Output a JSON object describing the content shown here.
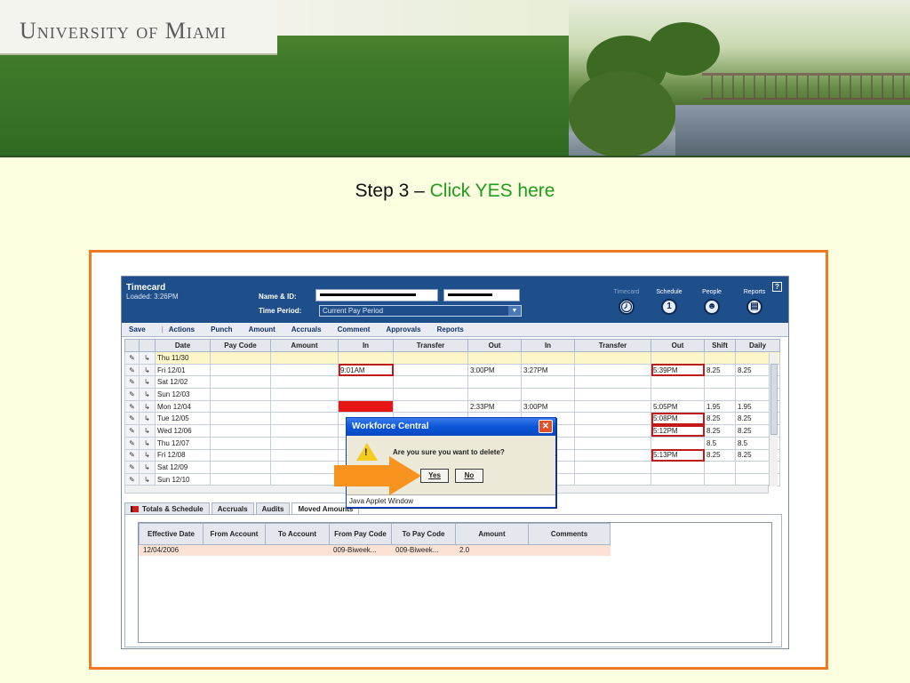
{
  "banner": {
    "logo_text": "University of Miami"
  },
  "step": {
    "prefix": "Step 3 – ",
    "highlight": "Click YES here"
  },
  "app": {
    "title": "Timecard",
    "loaded": "Loaded: 3:26PM",
    "name_label": "Name & ID:",
    "time_period_label": "Time Period:",
    "time_period_value": "Current Pay Period",
    "nav": [
      {
        "label": "Timecard",
        "glyph": ""
      },
      {
        "label": "Schedule",
        "glyph": "1"
      },
      {
        "label": "People",
        "glyph": "☻"
      },
      {
        "label": "Reports",
        "glyph": "▤"
      }
    ],
    "help": "?",
    "menu": [
      "Save",
      "Actions",
      "Punch",
      "Amount",
      "Accruals",
      "Comment",
      "Approvals",
      "Reports"
    ],
    "columns": [
      "",
      "",
      "Date",
      "Pay Code",
      "Amount",
      "In",
      "Transfer",
      "Out",
      "In",
      "Transfer",
      "Out",
      "Shift",
      "Daily"
    ],
    "rows": [
      {
        "date": "Thu 11/30",
        "in1": "",
        "out1": "",
        "in2": "",
        "out2": "",
        "shift": "",
        "daily": ""
      },
      {
        "date": "Fri 12/01",
        "in1": "9:01AM",
        "out1": "3:00PM",
        "in2": "3:27PM",
        "out2": "5:39PM",
        "shift": "8.25",
        "daily": "8.25"
      },
      {
        "date": "Sat 12/02",
        "in1": "",
        "out1": "",
        "in2": "",
        "out2": "",
        "shift": "",
        "daily": ""
      },
      {
        "date": "Sun 12/03",
        "in1": "",
        "out1": "",
        "in2": "",
        "out2": "",
        "shift": "",
        "daily": ""
      },
      {
        "date": "Mon 12/04",
        "in1": "",
        "out1": "2:33PM",
        "in2": "3:00PM",
        "out2": "5:05PM",
        "shift": "1.95",
        "daily": "1.95"
      },
      {
        "date": "Tue 12/05",
        "in1": "",
        "out1": "",
        "in2": "",
        "out2": "5:08PM",
        "shift": "8.25",
        "daily": "8.25"
      },
      {
        "date": "Wed 12/06",
        "in1": "",
        "out1": "",
        "in2": "",
        "out2": "5:12PM",
        "shift": "8.25",
        "daily": "8.25"
      },
      {
        "date": "Thu 12/07",
        "in1": "",
        "out1": "",
        "in2": "",
        "out2": "",
        "shift": "8.5",
        "daily": "8.5"
      },
      {
        "date": "Fri 12/08",
        "in1": "",
        "out1": "",
        "in2": "",
        "out2": "5:13PM",
        "shift": "8.25",
        "daily": "8.25"
      },
      {
        "date": "Sat 12/09",
        "in1": "",
        "out1": "",
        "in2": "",
        "out2": "",
        "shift": "",
        "daily": ""
      },
      {
        "date": "Sun 12/10",
        "in1": "",
        "out1": "",
        "in2": "",
        "out2": "",
        "shift": "",
        "daily": ""
      }
    ],
    "tabs": [
      "Totals & Schedule",
      "Accruals",
      "Audits",
      "Moved Amounts"
    ],
    "moved": {
      "columns": [
        "Effective Date",
        "From Account",
        "To Account",
        "From Pay Code",
        "To Pay Code",
        "Amount",
        "Comments"
      ],
      "row": [
        "12/04/2006",
        "",
        "",
        "009-Biweek...",
        "009-Biweek...",
        "2.0",
        ""
      ]
    }
  },
  "dialog": {
    "title": "Workforce Central",
    "close": "✕",
    "message": "Are you sure you want to delete?",
    "yes": "Yes",
    "no": "No",
    "status": "Java Applet Window"
  },
  "colors": {
    "highlight": "#1e9e1e",
    "frame": "#f07a22",
    "arrow": "#f7931e",
    "header_blue": "#1f4f8a"
  }
}
